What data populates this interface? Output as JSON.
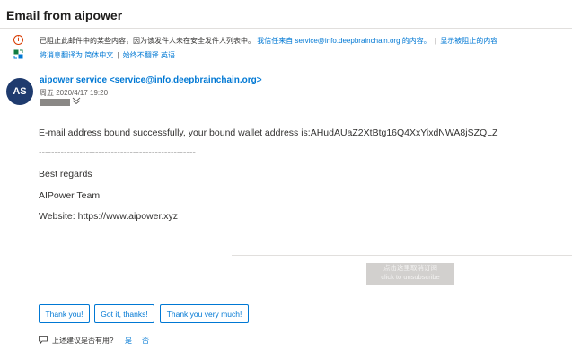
{
  "header": {
    "subject": "Email from aipower"
  },
  "infobar": {
    "blocked_text": "已阻止此邮件中的某些内容，因为该发件人未在安全发件人列表中。",
    "trust_link": "我信任来自 service@info.deepbrainchain.org 的内容。",
    "separator": "|",
    "show_blocked_link": "显示被阻止的内容",
    "translate_link": "将消息翻译为 简体中文",
    "never_translate_link": "始终不翻译 英语"
  },
  "message": {
    "avatar_initials": "AS",
    "sender": "aipower service <service@info.deepbrainchain.org>",
    "date": "周五 2020/4/17 19:20"
  },
  "body": {
    "line1": "E-mail address bound successfully, your bound wallet address is:AHudAUaZ2XtBtg16Q4XxYixdNWA8jSZQLZ",
    "divider": "--------------------------------------------------",
    "regards": "Best regards",
    "team": "AIPower Team",
    "website": "Website: https://www.aipower.xyz"
  },
  "unsubscribe": {
    "line1": "点击这里取消订阅",
    "line2": "click to unsubscribe"
  },
  "quick_replies": [
    "Thank you!",
    "Got it, thanks!",
    "Thank you very much!"
  ],
  "feedback": {
    "question": "上述建议是否有用?",
    "yes": "是",
    "no": "否"
  },
  "colors": {
    "accent": "#0078d4",
    "warning": "#d83b01",
    "avatar": "#1f3b6e"
  }
}
